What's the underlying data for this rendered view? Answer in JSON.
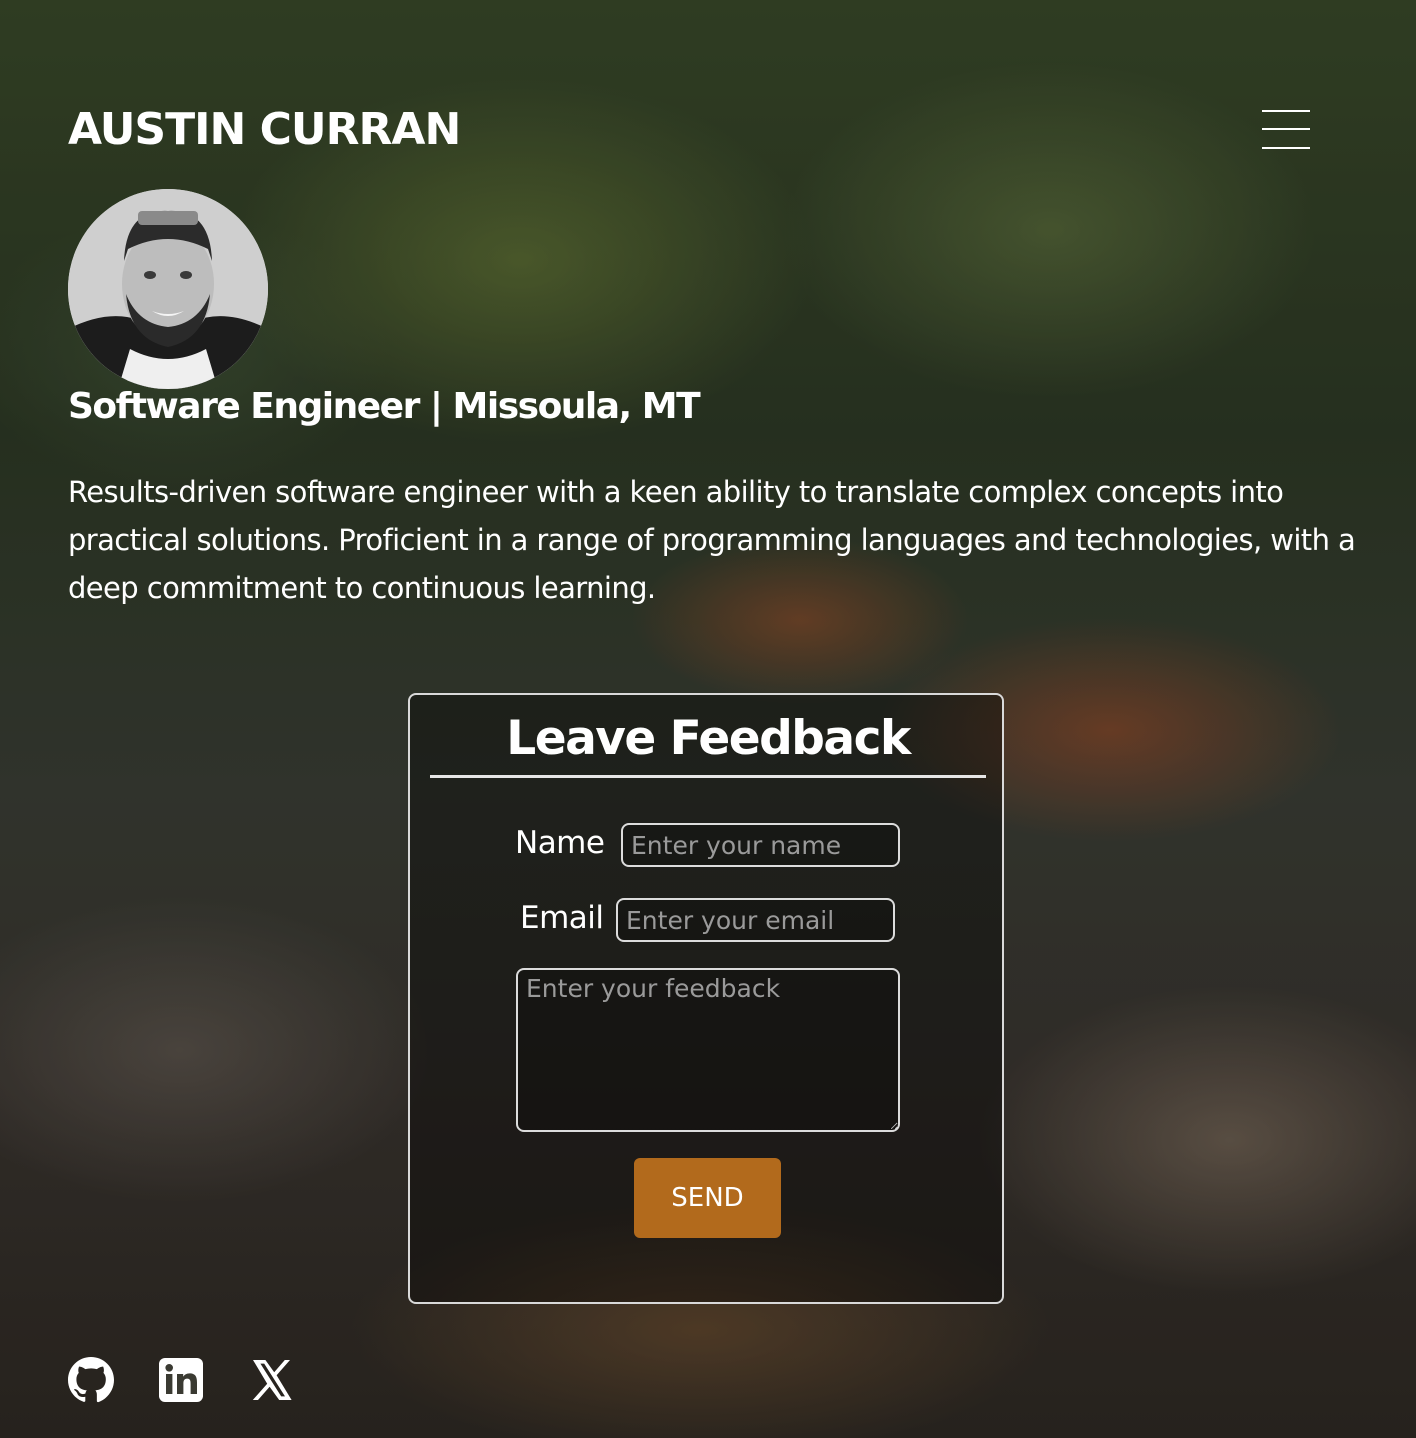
{
  "header": {
    "site_title": "AUSTIN CURRAN",
    "menu_icon": "hamburger-icon"
  },
  "profile": {
    "avatar_alt": "avatar",
    "subtitle": "Software Engineer | Missoula, MT",
    "bio": "Results-driven software engineer with a keen ability to translate complex concepts into practical solutions. Proficient in a range of programming languages and technologies, with a deep commitment to continuous learning."
  },
  "feedback": {
    "title": "Leave Feedback",
    "name_label": "Name",
    "name_placeholder": "Enter your name",
    "name_value": "",
    "email_label": "Email",
    "email_placeholder": "Enter your email",
    "email_value": "",
    "feedback_placeholder": "Enter your feedback",
    "feedback_value": "",
    "send_label": "SEND"
  },
  "social": [
    {
      "icon": "github-icon"
    },
    {
      "icon": "linkedin-icon"
    },
    {
      "icon": "x-icon"
    }
  ],
  "colors": {
    "accent": "#b26a1c",
    "text": "#ffffff",
    "border": "#dcdcdc"
  }
}
